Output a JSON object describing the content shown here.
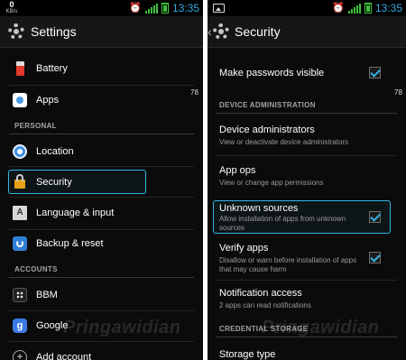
{
  "left_screen": {
    "status": {
      "speed_value": "0",
      "speed_unit": "KB/s",
      "time": "13:35"
    },
    "title": "Settings",
    "items": [
      {
        "label": "Battery",
        "icon": "battery-icon"
      },
      {
        "label": "Apps",
        "icon": "apps-icon"
      },
      {
        "label": "Location",
        "icon": "location-icon"
      },
      {
        "label": "Security",
        "icon": "lock-icon"
      },
      {
        "label": "Language & input",
        "icon": "language-icon"
      },
      {
        "label": "Backup & reset",
        "icon": "backup-icon"
      },
      {
        "label": "BBM",
        "icon": "bbm-icon"
      },
      {
        "label": "Google",
        "icon": "google-icon"
      },
      {
        "label": "Add account",
        "icon": "add-icon"
      }
    ],
    "headers": {
      "personal": "PERSONAL",
      "accounts": "ACCOUNTS"
    },
    "side_number": "78",
    "icon_glyphs": {
      "language": "A",
      "google": "g",
      "add": "+"
    },
    "watermark": "Pringawidian"
  },
  "right_screen": {
    "status": {
      "time": "13:35"
    },
    "title": "Security",
    "up_caret": "‹",
    "items": [
      {
        "label": "Make passwords visible",
        "checked": true
      },
      {
        "label": "Device administrators",
        "summary": "View or deactivate device administrators"
      },
      {
        "label": "App ops",
        "summary": "View or change app permissions"
      },
      {
        "label": "Unknown sources",
        "summary": "Allow installation of apps from unknown sources",
        "checked": true
      },
      {
        "label": "Verify apps",
        "summary": "Disallow or warn before installation of apps that may cause harm",
        "checked": true
      },
      {
        "label": "Notification access",
        "summary": "2 apps can read notifications"
      },
      {
        "label": "Storage type"
      }
    ],
    "headers": {
      "device_admin": "DEVICE ADMINISTRATION",
      "credential": "CREDENTIAL STORAGE"
    },
    "side_number": "78",
    "watermark": "Pringawidian"
  },
  "colors": {
    "accent": "#33b5e5",
    "time": "#36a6e0",
    "signal": "#3fbf3f",
    "background": "#0b0b0b"
  }
}
